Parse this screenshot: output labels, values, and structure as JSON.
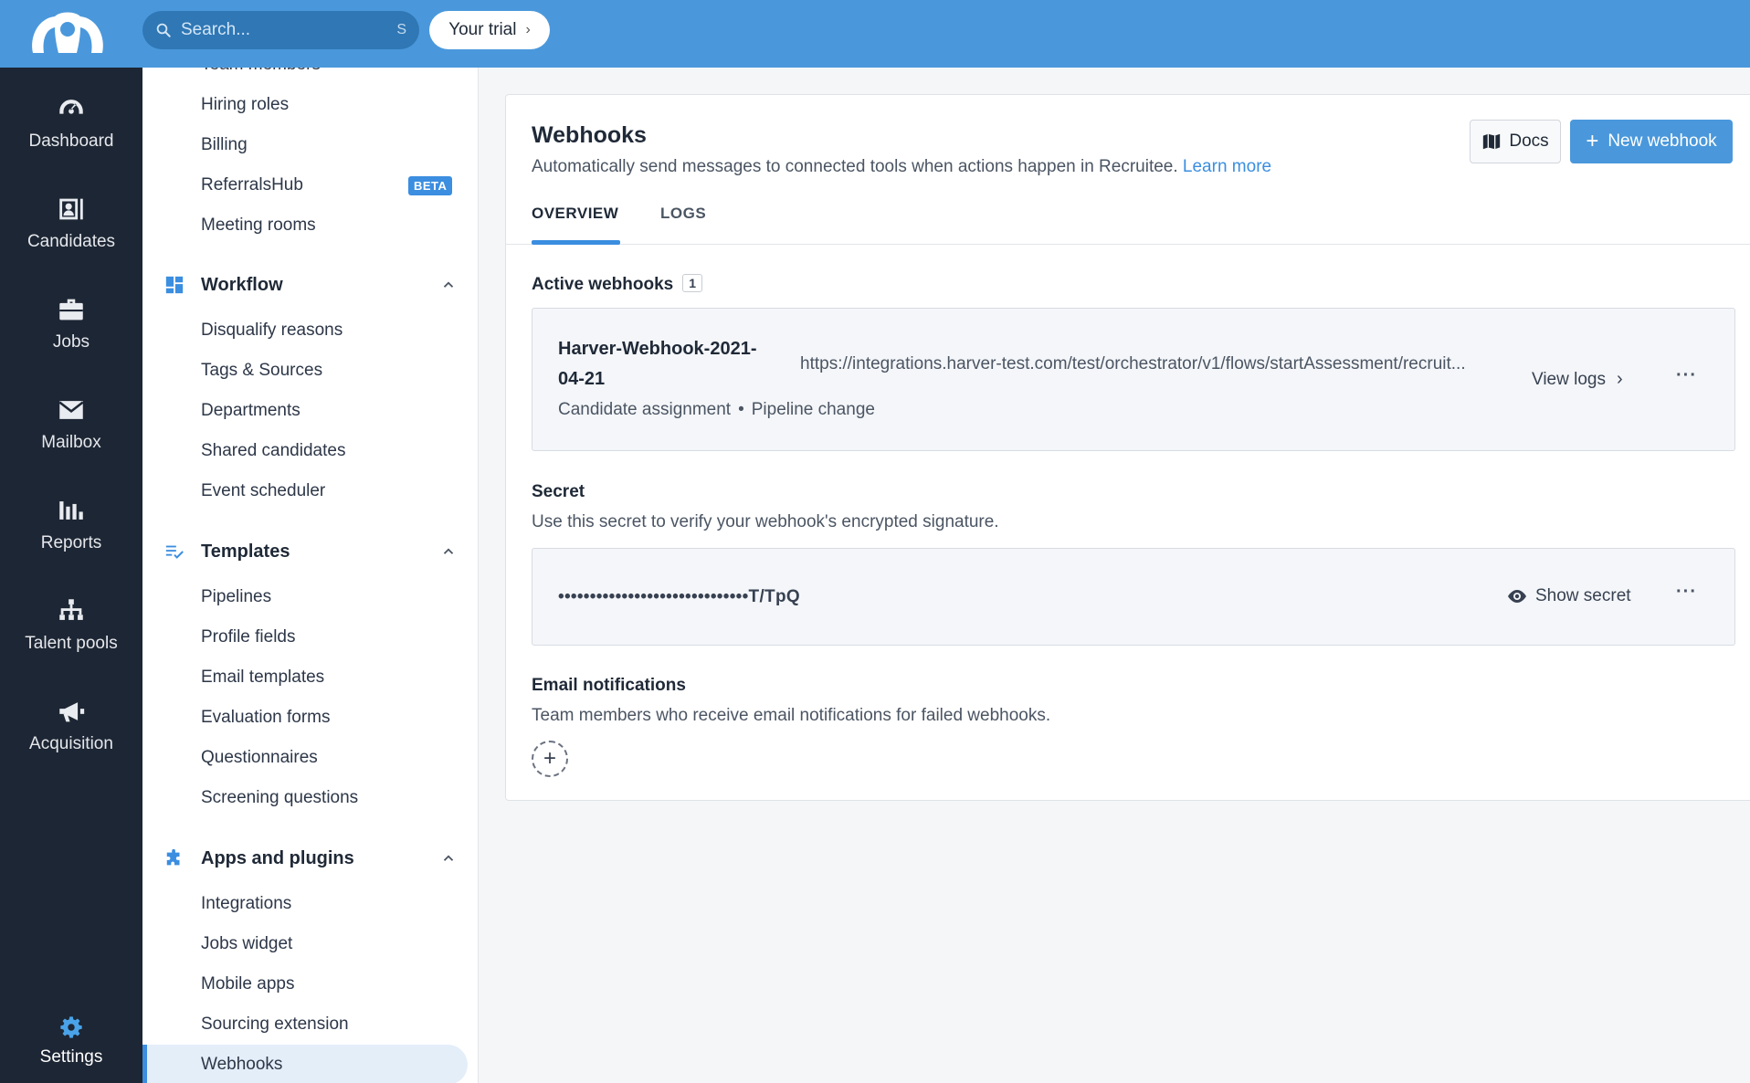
{
  "topbar": {
    "search_placeholder": "Search...",
    "search_shortcut": "S",
    "trial_label": "Your trial"
  },
  "leftnav": {
    "items": [
      {
        "label": "Dashboard",
        "icon": "gauge-icon"
      },
      {
        "label": "Candidates",
        "icon": "contact-card-icon"
      },
      {
        "label": "Jobs",
        "icon": "briefcase-icon"
      },
      {
        "label": "Mailbox",
        "icon": "envelope-icon"
      },
      {
        "label": "Reports",
        "icon": "bar-chart-icon"
      },
      {
        "label": "Talent pools",
        "icon": "org-chart-icon"
      },
      {
        "label": "Acquisition",
        "icon": "megaphone-icon"
      }
    ],
    "settings_label": "Settings"
  },
  "sidebar": {
    "cut_off_label": "Team members",
    "company_links": [
      "Hiring roles",
      "Billing",
      "ReferralsHub",
      "Meeting rooms"
    ],
    "beta_label": "BETA",
    "workflow": {
      "title": "Workflow",
      "links": [
        "Disqualify reasons",
        "Tags & Sources",
        "Departments",
        "Shared candidates",
        "Event scheduler"
      ]
    },
    "templates": {
      "title": "Templates",
      "links": [
        "Pipelines",
        "Profile fields",
        "Email templates",
        "Evaluation forms",
        "Questionnaires",
        "Screening questions"
      ]
    },
    "apps": {
      "title": "Apps and plugins",
      "links": [
        "Integrations",
        "Jobs widget",
        "Mobile apps",
        "Sourcing extension",
        "Webhooks"
      ]
    }
  },
  "main": {
    "title": "Webhooks",
    "subtitle": "Automatically send messages to connected tools when actions happen in Recruitee.",
    "learn_more": "Learn more",
    "docs_label": "Docs",
    "new_webhook_label": "New webhook",
    "tabs": [
      "OVERVIEW",
      "LOGS"
    ],
    "active_webhooks": {
      "heading": "Active webhooks",
      "count": "1",
      "webhook": {
        "name": "Harver-Webhook-2021-04-21",
        "url": "https://integrations.harver-test.com/test/orchestrator/v1/flows/startAssessment/recruit...",
        "events": [
          "Candidate assignment",
          "Pipeline change"
        ],
        "view_logs": "View logs"
      }
    },
    "secret": {
      "heading": "Secret",
      "description": "Use this secret to verify your webhook's encrypted signature.",
      "masked_value": "••••••••••••••••••••••••••••••T/TpQ",
      "show_label": "Show secret"
    },
    "email_notifications": {
      "heading": "Email notifications",
      "description": "Team members who receive email notifications for failed webhooks."
    }
  },
  "colors": {
    "accent": "#4a98db",
    "nav_bg": "#1d2634"
  }
}
